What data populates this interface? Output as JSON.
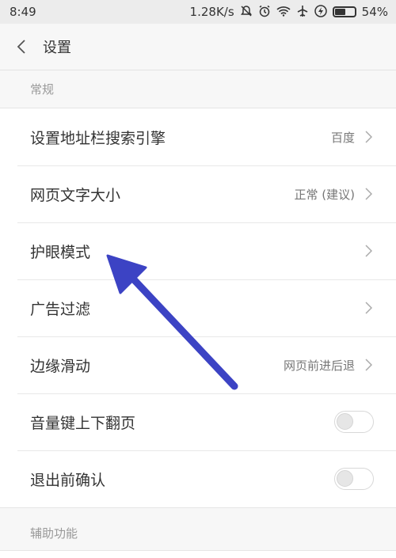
{
  "status": {
    "time": "8:49",
    "speed": "1.28K/s",
    "icons": [
      "mute-icon",
      "alarm-icon",
      "wifi-icon",
      "airplane-icon",
      "charging-icon"
    ],
    "battery_percent": "54%",
    "battery_level": 0.54
  },
  "header": {
    "title": "设置"
  },
  "sections": {
    "general": "常规",
    "accessibility": "辅助功能"
  },
  "settings": {
    "search_engine": {
      "label": "设置地址栏搜索引擎",
      "value": "百度"
    },
    "font_size": {
      "label": "网页文字大小",
      "value": "正常 (建议)"
    },
    "eye_care": {
      "label": "护眼模式"
    },
    "ad_filter": {
      "label": "广告过滤"
    },
    "edge_swipe": {
      "label": "边缘滑动",
      "value": "网页前进后退"
    },
    "volume_paging": {
      "label": "音量键上下翻页",
      "enabled": false
    },
    "exit_confirm": {
      "label": "退出前确认",
      "enabled": false
    }
  },
  "colors": {
    "annotation_arrow": "#3c43c4"
  }
}
